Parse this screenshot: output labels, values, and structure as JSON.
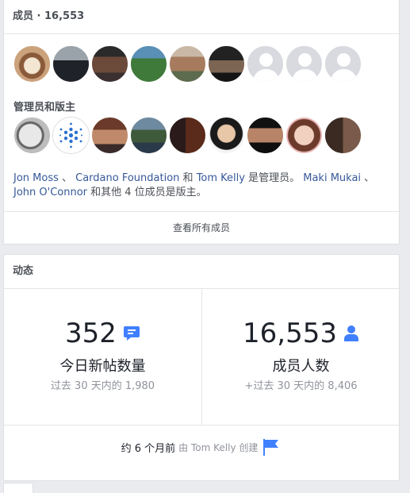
{
  "members": {
    "header": "成员 · 16,553",
    "admins_label": "管理员和版主",
    "description_parts": [
      "Jon Moss",
      " 、 ",
      "Cardano Foundation",
      " 和 ",
      "Tom Kelly",
      " 是管理员。 ",
      "Maki Mukai",
      " 、 ",
      "John O'Connor",
      " 和其他 4 位成员是版主。"
    ],
    "see_all": "查看所有成员",
    "member_avatars": [
      "coffee",
      "man-suit",
      "man-cap",
      "golfer",
      "man-glasses",
      "man-dark",
      "placeholder",
      "placeholder",
      "placeholder"
    ],
    "admin_avatars": [
      "cartoon",
      "cardano-logo",
      "man-red",
      "mountain",
      "couple",
      "woman-smile",
      "man-beard",
      "woman-pink",
      "group"
    ]
  },
  "activity": {
    "header": "动态",
    "posts_count": "352",
    "posts_label": "今日新帖数量",
    "posts_sub": "过去 30 天内的 1,980",
    "members_count": "16,553",
    "members_label": "成员人数",
    "members_sub": "+过去 30 天内的 8,406",
    "created_prefix": "约 6 个月前",
    "created_by": "由 Tom Kelly 创建"
  },
  "colors": {
    "accent": "#4080ff",
    "link": "#365899",
    "muted": "#90949c"
  }
}
